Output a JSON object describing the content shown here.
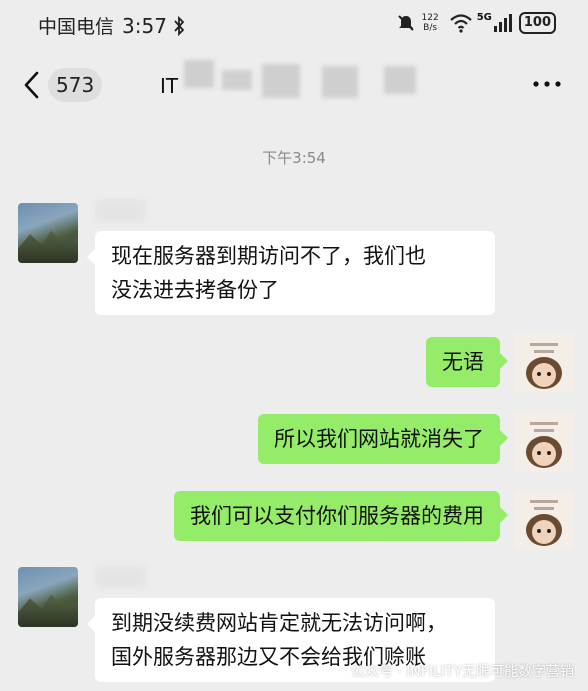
{
  "status_bar": {
    "carrier": "中国电信",
    "time": "3:57",
    "net_speed_value": "122",
    "net_speed_unit": "B/s",
    "network_type": "5G",
    "battery": "100",
    "icons": [
      "bluetooth-icon",
      "mute-icon",
      "wifi-icon",
      "signal-icon",
      "battery-icon"
    ]
  },
  "nav": {
    "unread_count": "573",
    "title": "IT",
    "icons": [
      "back-icon",
      "more-icon"
    ]
  },
  "chat": {
    "timestamp": "下午3:54",
    "messages": [
      {
        "side": "in",
        "lines": [
          "现在服务器到期访问不了，我们也",
          "没法进去拷备份了"
        ]
      },
      {
        "side": "out",
        "lines": [
          "无语"
        ]
      },
      {
        "side": "out",
        "lines": [
          "所以我们网站就消失了"
        ]
      },
      {
        "side": "out",
        "lines": [
          "我们可以支付你们服务器的费用"
        ]
      },
      {
        "side": "in",
        "lines": [
          "到期没续费网站肯定就无法访问啊，",
          "国外服务器那边又不会给我们赊账"
        ]
      }
    ]
  },
  "watermark": "公众号 · INFILITY无限可能数字营销",
  "colors": {
    "background": "#ededed",
    "outgoing_bubble": "#95ec69",
    "incoming_bubble": "#ffffff",
    "timestamp": "#8a8a8a"
  }
}
